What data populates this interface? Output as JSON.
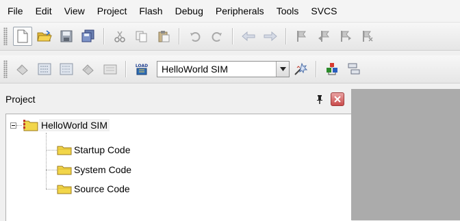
{
  "menubar": {
    "items": [
      "File",
      "Edit",
      "View",
      "Project",
      "Flash",
      "Debug",
      "Peripherals",
      "Tools",
      "SVCS"
    ]
  },
  "toolbar_file": {
    "icons": [
      "new-file-icon",
      "open-folder-icon",
      "save-icon",
      "save-all-icon",
      "cut-icon",
      "copy-icon",
      "paste-icon",
      "undo-icon",
      "redo-icon",
      "navigate-back-icon",
      "navigate-forward-icon",
      "bookmark-icon",
      "bookmark-previous-icon",
      "bookmark-next-icon",
      "bookmark-clear-icon"
    ]
  },
  "toolbar_build": {
    "icons": [
      "translate-icon",
      "build-icon",
      "rebuild-icon",
      "batch-build-icon",
      "stop-build-icon",
      "download-icon",
      "target-options-icon",
      "manage-components-icon",
      "manage-books-icon"
    ],
    "download_icon_text": "LOAD",
    "target": {
      "selected": "HelloWorld SIM"
    }
  },
  "project_pane": {
    "title": "Project",
    "tree": {
      "root": "HelloWorld SIM",
      "groups": [
        "Startup Code",
        "System Code",
        "Source Code"
      ]
    }
  },
  "colors": {
    "folder": "#f2d64a",
    "editor_background": "#ababab",
    "close_button": "#c94b4b"
  }
}
